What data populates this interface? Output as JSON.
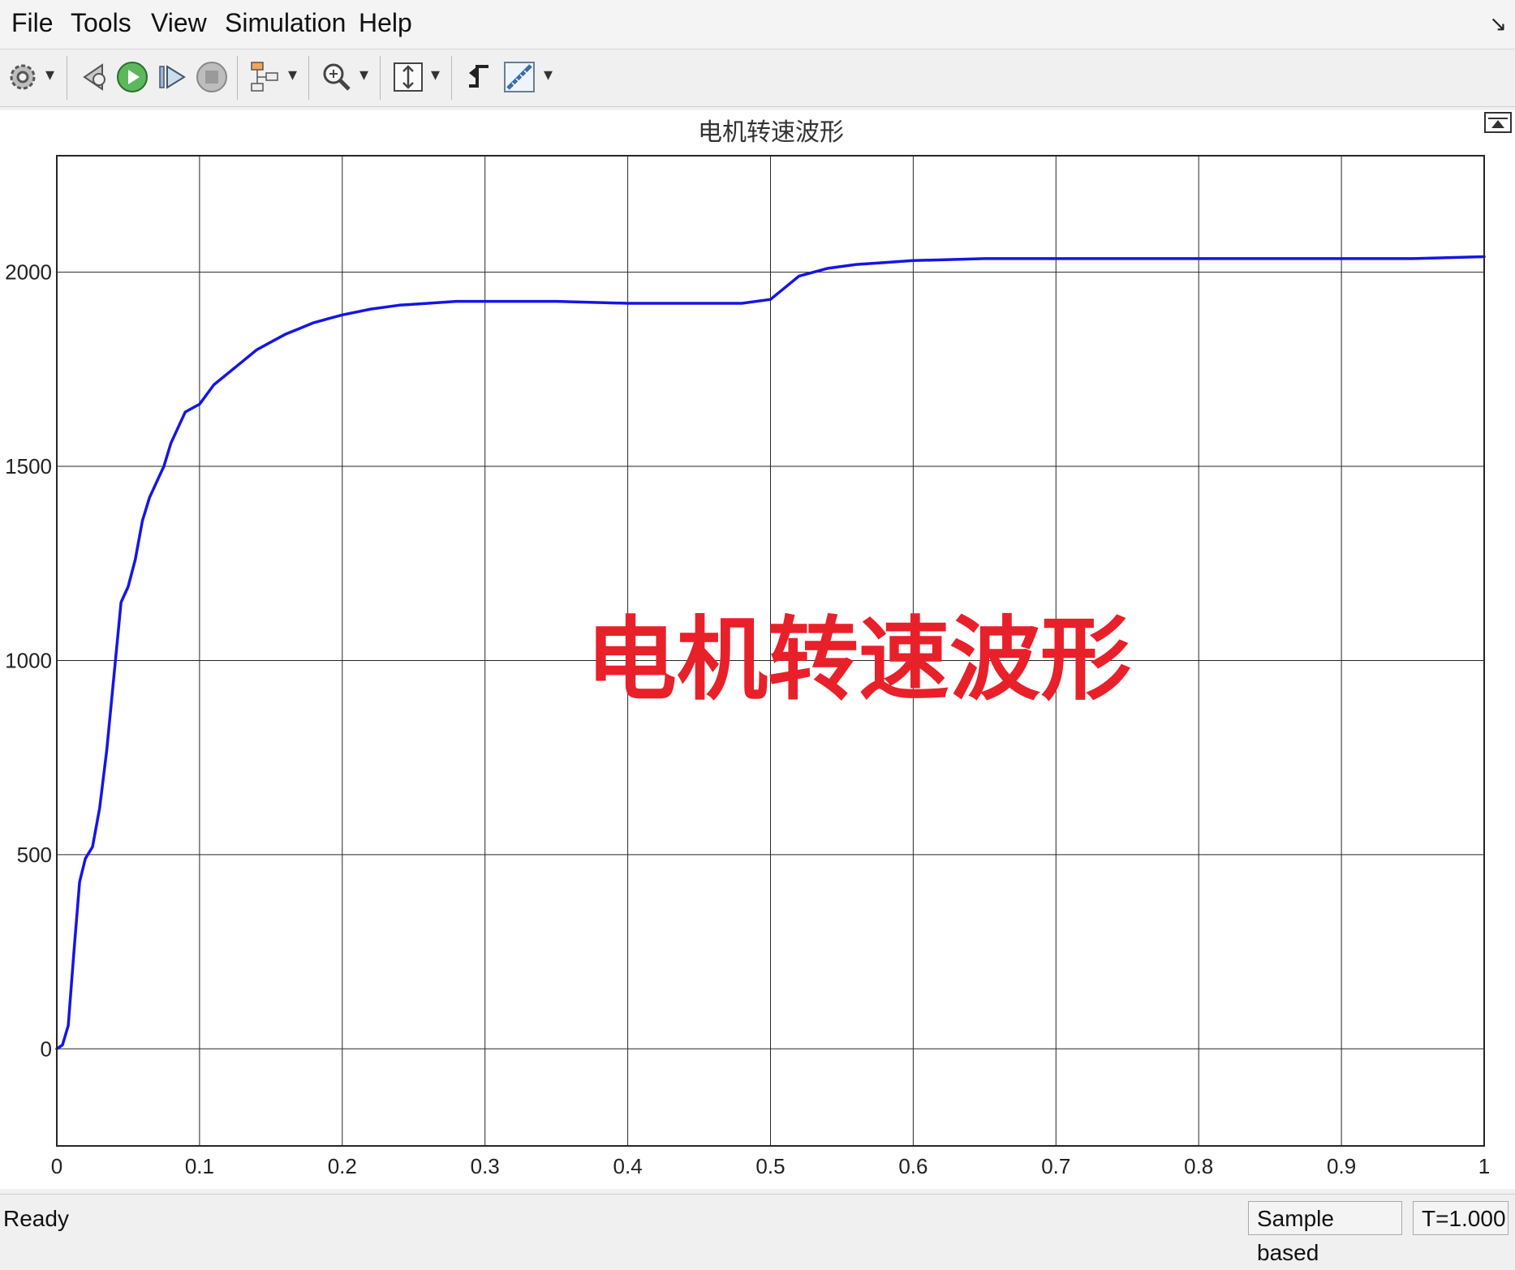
{
  "menu": {
    "items": [
      "File",
      "Tools",
      "View",
      "Simulation",
      "Help"
    ]
  },
  "toolbar": {
    "buttons": [
      {
        "icon": "gear-icon"
      },
      {
        "icon": "step-back-icon"
      },
      {
        "icon": "run-icon"
      },
      {
        "icon": "step-forward-icon"
      },
      {
        "icon": "stop-icon"
      },
      {
        "icon": "highlight-model-icon"
      },
      {
        "icon": "zoom-icon"
      },
      {
        "icon": "autoscale-icon"
      },
      {
        "icon": "trigger-icon"
      },
      {
        "icon": "measurements-icon"
      }
    ]
  },
  "overlay_text": "电机转速波形",
  "colors": {
    "line": "#1515e6",
    "overlay": "#e8202a",
    "grid": "#262626"
  },
  "status": {
    "text": "Ready",
    "mode": "Sample based",
    "time": "T=1.000"
  },
  "chart_data": {
    "type": "line",
    "title": "电机转速波形",
    "xlabel": "",
    "ylabel": "",
    "xlim": [
      0,
      1
    ],
    "ylim": [
      -250,
      2300
    ],
    "xticks": [
      0,
      0.1,
      0.2,
      0.3,
      0.4,
      0.5,
      0.6,
      0.7,
      0.8,
      0.9,
      1
    ],
    "xtick_labels": [
      "0",
      "0.1",
      "0.2",
      "0.3",
      "0.4",
      "0.5",
      "0.6",
      "0.7",
      "0.8",
      "0.9",
      "1"
    ],
    "yticks": [
      0,
      500,
      1000,
      1500,
      2000
    ],
    "ytick_labels": [
      "0",
      "500",
      "1000",
      "1500",
      "2000"
    ],
    "grid": true,
    "series": [
      {
        "x": [
          0,
          0.004,
          0.008,
          0.012,
          0.016,
          0.02,
          0.025,
          0.03,
          0.035,
          0.04,
          0.045,
          0.05,
          0.055,
          0.06,
          0.065,
          0.07,
          0.075,
          0.08,
          0.09,
          0.1,
          0.11,
          0.12,
          0.13,
          0.14,
          0.15,
          0.16,
          0.17,
          0.18,
          0.19,
          0.2,
          0.22,
          0.24,
          0.26,
          0.28,
          0.3,
          0.35,
          0.4,
          0.45,
          0.48,
          0.5,
          0.51,
          0.52,
          0.54,
          0.56,
          0.58,
          0.6,
          0.65,
          0.7,
          0.75,
          0.8,
          0.85,
          0.9,
          0.95,
          1.0
        ],
        "y": [
          0,
          10,
          60,
          250,
          430,
          490,
          520,
          620,
          770,
          960,
          1150,
          1190,
          1260,
          1360,
          1420,
          1460,
          1500,
          1560,
          1640,
          1660,
          1710,
          1740,
          1770,
          1800,
          1820,
          1840,
          1855,
          1870,
          1880,
          1890,
          1905,
          1915,
          1920,
          1925,
          1925,
          1925,
          1920,
          1920,
          1920,
          1930,
          1960,
          1990,
          2010,
          2020,
          2025,
          2030,
          2035,
          2035,
          2035,
          2035,
          2035,
          2035,
          2035,
          2040
        ]
      }
    ]
  }
}
